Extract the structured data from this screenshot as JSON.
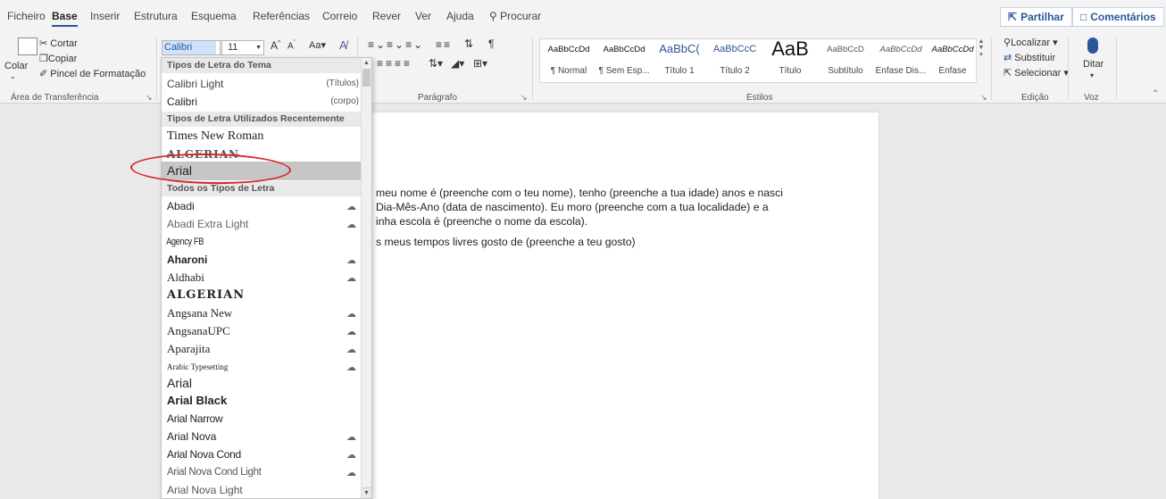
{
  "menu": {
    "items": [
      "Ficheiro",
      "Base",
      "Inserir",
      "Estrutura",
      "Esquema",
      "Referências",
      "Correio",
      "Rever",
      "Ver",
      "Ajuda"
    ],
    "search_label": "Procurar",
    "share_label": "Partilhar",
    "comments_label": "Comentários"
  },
  "clipboard": {
    "paste_label": "Colar",
    "cut_label": "Cortar",
    "copy_label": "Copiar",
    "format_painter_label": "Pincel de Formatação",
    "group_label": "Área de Transferência"
  },
  "font": {
    "current_font": "Calibri",
    "current_size": "11",
    "grow_label": "A",
    "shrink_label": "A",
    "case_label": "Aa"
  },
  "paragraph": {
    "group_label": "Parágrafo"
  },
  "styles": {
    "group_label": "Estilos",
    "items": [
      {
        "preview": "AaBbCcDd",
        "label": "¶ Normal"
      },
      {
        "preview": "AaBbCcDd",
        "label": "¶ Sem Esp..."
      },
      {
        "preview": "AaBbC(",
        "label": "Título 1"
      },
      {
        "preview": "AaBbCcC",
        "label": "Título 2"
      },
      {
        "preview": "AaB",
        "label": "Título"
      },
      {
        "preview": "AaBbCcD",
        "label": "Subtítulo"
      },
      {
        "preview": "AaBbCcDd",
        "label": "Ênfase Dis..."
      },
      {
        "preview": "AaBbCcDd",
        "label": "Ênfase"
      }
    ]
  },
  "editing": {
    "find_label": "Localizar",
    "replace_label": "Substituir",
    "select_label": "Selecionar",
    "group_label": "Edição"
  },
  "voice": {
    "dictate_label": "Ditar",
    "group_label": "Voz"
  },
  "font_dropdown": {
    "theme_header": "Tipos de Letra do Tema",
    "theme_fonts": [
      {
        "name": "Calibri Light",
        "note": "(Títulos)"
      },
      {
        "name": "Calibri",
        "note": "(corpo)"
      }
    ],
    "recent_header": "Tipos de Letra Utilizados Recentemente",
    "recent_fonts": [
      "Times New Roman",
      "ALGERIAN",
      "Arial"
    ],
    "all_header": "Todos os Tipos de Letra",
    "all_fonts": [
      "Abadi",
      "Abadi Extra Light",
      "Agency FB",
      "Aharoni",
      "Aldhabi",
      "ALGERIAN",
      "Angsana New",
      "AngsanaUPC",
      "Aparajita",
      "Arabic Typesetting",
      "Arial",
      "Arial Black",
      "Arial Narrow",
      "Arial Nova",
      "Arial Nova Cond",
      "Arial Nova Cond Light",
      "Arial Nova Light"
    ]
  },
  "document": {
    "lines": [
      "meu nome é (preenche com o teu nome), tenho (preenche a tua idade) anos e nasci",
      "Dia-Mês-Ano (data de nascimento). Eu moro (preenche com a tua localidade) e a",
      "inha escola é (preenche o nome da escola).",
      "s meus tempos livres gosto de (preenche a teu gosto)"
    ]
  }
}
